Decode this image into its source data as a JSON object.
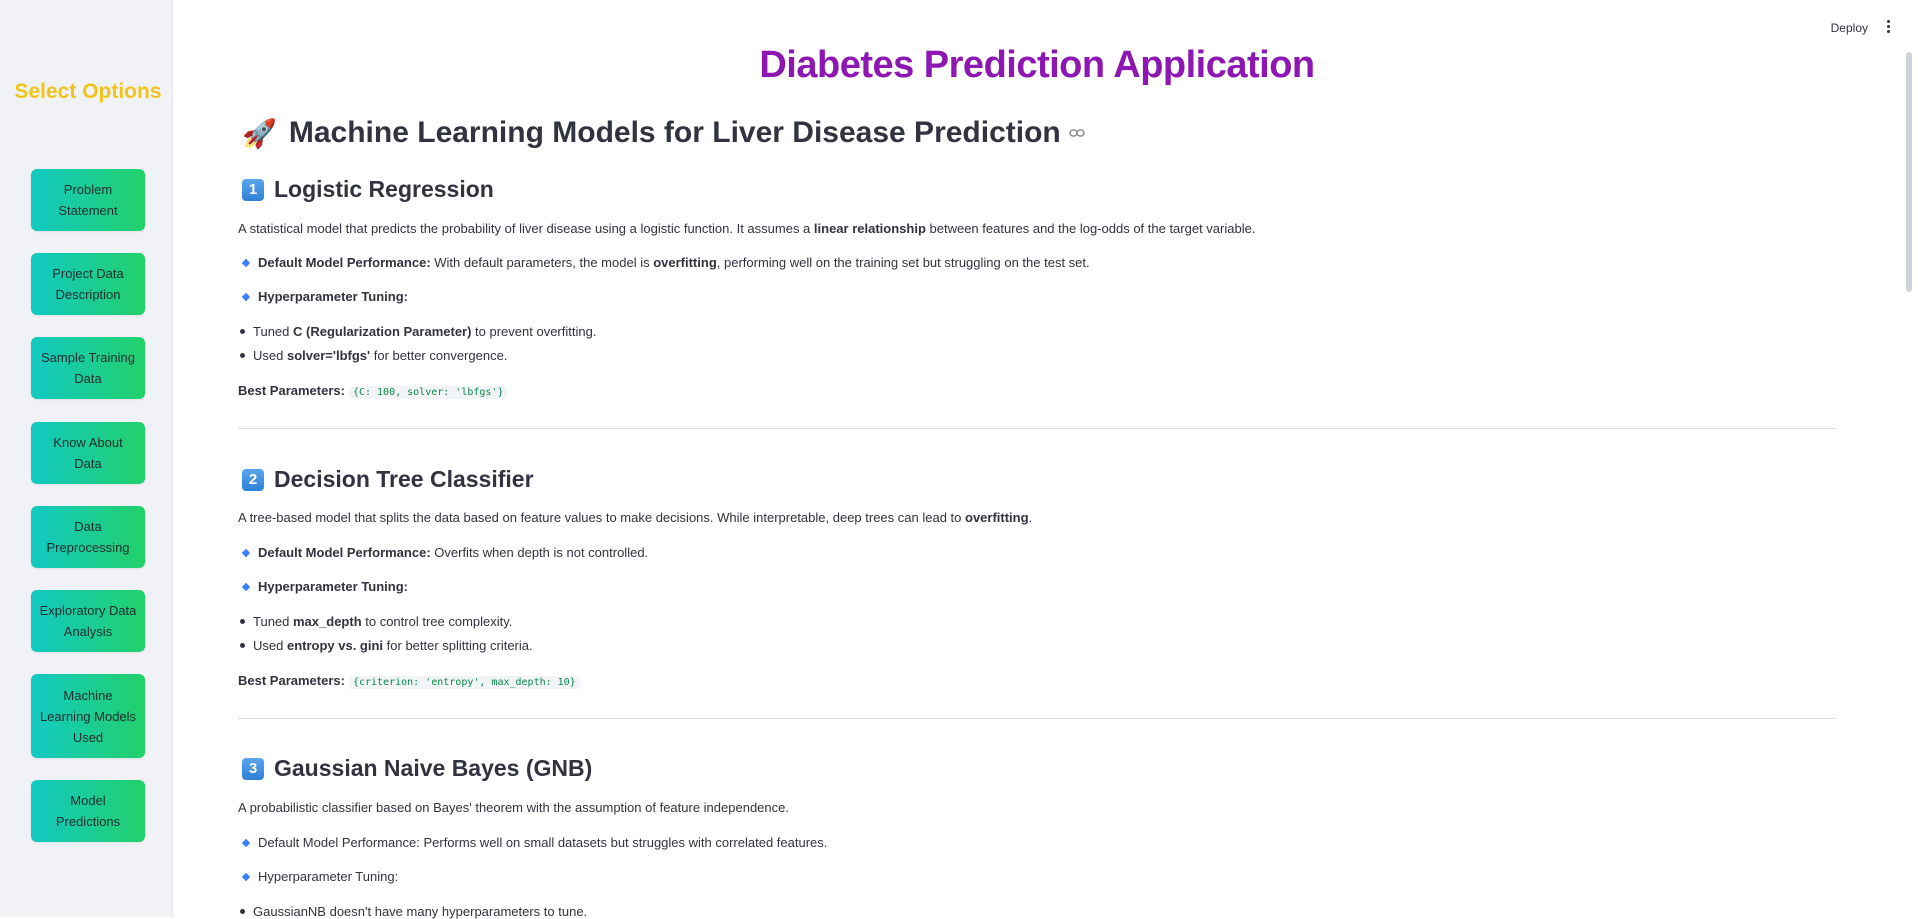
{
  "sidebar": {
    "title": "Select Options",
    "items": [
      {
        "label": "Problem Statement"
      },
      {
        "label": "Project Data Description"
      },
      {
        "label": "Sample Training Data"
      },
      {
        "label": "Know About Data"
      },
      {
        "label": "Data Preprocessing"
      },
      {
        "label": "Exploratory Data Analysis"
      },
      {
        "label": "Machine Learning Models Used"
      },
      {
        "label": "Model Predictions"
      }
    ]
  },
  "header": {
    "deploy_label": "Deploy"
  },
  "main": {
    "app_title": "Diabetes Prediction Application",
    "section_title": "Machine Learning Models for Liver Disease Prediction",
    "models": [
      {
        "number": "1",
        "title": "Logistic Regression",
        "desc_a": "A statistical model that predicts the probability of liver disease using a logistic function. It assumes a ",
        "desc_bold": "linear relationship",
        "desc_b": " between features and the log-odds of the target variable.",
        "perf_label": "Default Model Performance:",
        "perf_a": " With default parameters, the model is ",
        "perf_bold": "overfitting",
        "perf_b": ", performing well on the training set but struggling on the test set.",
        "tuning_label": "Hyperparameter Tuning:",
        "tuned1_a": "Tuned ",
        "tuned1_bold": "C (Regularization Parameter)",
        "tuned1_b": " to prevent overfitting.",
        "tuned2_a": "Used ",
        "tuned2_bold": "solver='lbfgs'",
        "tuned2_b": " for better convergence.",
        "best_label": "Best Parameters:",
        "best_code": "{C: 100, solver: 'lbfgs'}"
      },
      {
        "number": "2",
        "title": "Decision Tree Classifier",
        "desc_a": "A tree-based model that splits the data based on feature values to make decisions. While interpretable, deep trees can lead to ",
        "desc_bold": "overfitting",
        "desc_b": ".",
        "perf_label": "Default Model Performance:",
        "perf_a": " Overfits when depth is not controlled.",
        "tuning_label": "Hyperparameter Tuning:",
        "tuned1_a": "Tuned ",
        "tuned1_bold": "max_depth",
        "tuned1_b": " to control tree complexity.",
        "tuned2_a": "Used ",
        "tuned2_bold": "entropy vs. gini",
        "tuned2_b": " for better splitting criteria.",
        "best_label": "Best Parameters:",
        "best_code": "{criterion: 'entropy', max_depth: 10}"
      },
      {
        "number": "3",
        "title": "Gaussian Naive Bayes (GNB)",
        "desc": "A probabilistic classifier based on Bayes' theorem with the assumption of feature independence.",
        "perf": "Default Model Performance: Performs well on small datasets but struggles with correlated features.",
        "tuning": "Hyperparameter Tuning:",
        "tuned1": "GaussianNB doesn't have many hyperparameters to tune."
      }
    ]
  },
  "colors": {
    "title_purple": "#8e17b3",
    "sidebar_title_yellow": "#f0c419",
    "button_gradient_start": "#12c9c2",
    "button_gradient_end": "#22d06a"
  }
}
